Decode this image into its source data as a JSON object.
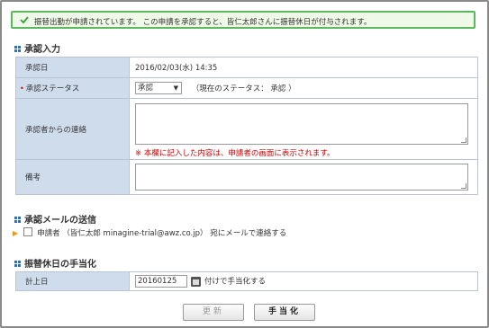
{
  "banner": {
    "message": "振替出勤が申請されています。 この申請を承認すると、皆仁太郎さんに振替休日が付与されます。"
  },
  "approval_input": {
    "section_title": "承認入力",
    "date_label": "承認日",
    "date_value": "2016/02/03(水) 14:35",
    "status_label": "承認ステータス",
    "required_mark": "•",
    "status_selected": "承認",
    "current_status_text": "（現在のステータス： 承認 ）",
    "contact_label": "承認者からの連絡",
    "contact_note": "※ 本欄に記入した内容は、申請者の画面に表示されます。",
    "remarks_label": "備考"
  },
  "mail": {
    "section_title": "承認メールの送信",
    "checkbox_text": "申請者 （皆仁太郎 minagine-trial@awz.co.jp） 宛にメールで連絡する"
  },
  "compensation": {
    "section_title": "振替休日の手当化",
    "date_label": "計上日",
    "date_value": "20160125",
    "suffix_text": "付けで手当化する"
  },
  "buttons": {
    "update": "更新",
    "allowance": "手当化"
  },
  "colors": {
    "banner_border": "#5cb85c",
    "label_bg": "#cfdcec",
    "warning": "#cc0000"
  }
}
